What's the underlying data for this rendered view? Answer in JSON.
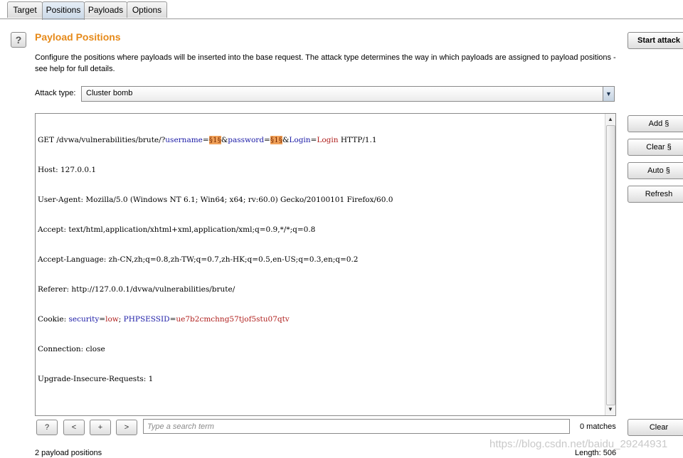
{
  "tabs": [
    {
      "label": "Target",
      "active": false
    },
    {
      "label": "Positions",
      "active": true
    },
    {
      "label": "Payloads",
      "active": false
    },
    {
      "label": "Options",
      "active": false
    }
  ],
  "panel": {
    "title": "Payload Positions",
    "description": "Configure the positions where payloads will be inserted into the base request. The attack type determines the way in which payloads are assigned to payload positions - see help for full details.",
    "attack_type_label": "Attack type:",
    "attack_type_value": "Cluster bomb"
  },
  "request": {
    "line1": {
      "prefix": "GET /dvwa/vulnerabilities/brute/?",
      "param1_name": "username",
      "eq1": "=",
      "marker1": "§1§",
      "amp2": "&",
      "param2_name": "password",
      "eq2": "=",
      "marker2": "§1§",
      "amp3": "&",
      "param3_name": "Login",
      "eq3": "=",
      "param3_value": "Login",
      "suffix": " HTTP/1.1"
    },
    "host": "Host: 127.0.0.1",
    "user_agent": "User-Agent: Mozilla/5.0 (Windows NT 6.1; Win64; x64; rv:60.0) Gecko/20100101 Firefox/60.0",
    "accept": "Accept: text/html,application/xhtml+xml,application/xml;q=0.9,*/*;q=0.8",
    "accept_language": "Accept-Language: zh-CN,zh;q=0.8,zh-TW;q=0.7,zh-HK;q=0.5,en-US;q=0.3,en;q=0.2",
    "referer": "Referer: http://127.0.0.1/dvwa/vulnerabilities/brute/",
    "cookie": {
      "prefix": "Cookie: ",
      "name1": "security",
      "eq1": "=",
      "value1": "low",
      "sep": "; ",
      "name2": "PHPSESSID",
      "eq2": "=",
      "value2": "ue7b2cmchng57tjof5stu07qtv"
    },
    "connection": "Connection: close",
    "upgrade": "Upgrade-Insecure-Requests: 1"
  },
  "buttons": {
    "start_attack": "Start attack",
    "add": "Add §",
    "clear_marker": "Clear §",
    "auto": "Auto §",
    "refresh": "Refresh",
    "clear": "Clear"
  },
  "search": {
    "help_label": "?",
    "prev_label": "<",
    "add_label": "+",
    "next_label": ">",
    "placeholder": "Type a search term",
    "matches": "0 matches"
  },
  "status": {
    "payload_positions": "2 payload positions",
    "length": "Length: 506"
  },
  "watermark": "https://blog.csdn.net/baidu_29244931"
}
